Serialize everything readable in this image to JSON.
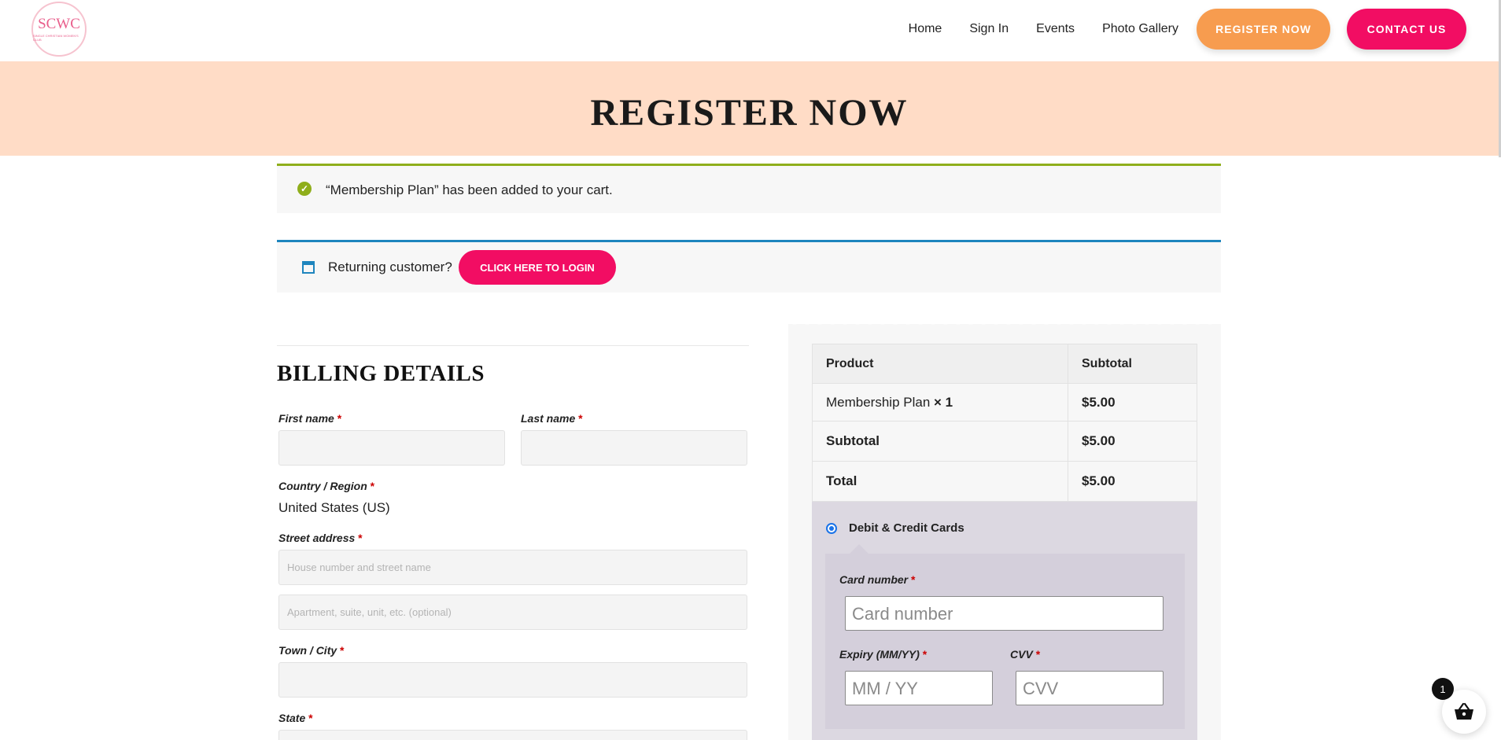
{
  "header": {
    "logo_text": "SCWC",
    "logo_subtext": "SINGLE CHRISTIAN WOMEN'S CLUB",
    "nav": [
      {
        "label": "Home"
      },
      {
        "label": "Sign In"
      },
      {
        "label": "Events"
      },
      {
        "label": "Photo Gallery"
      }
    ],
    "register_label": "REGISTER NOW",
    "contact_label": "CONTACT US"
  },
  "hero": {
    "title": "REGISTER NOW"
  },
  "notices": {
    "cart_message": "“Membership Plan” has been added to your cart.",
    "returning_text": "Returning customer?",
    "login_button": "CLICK HERE TO LOGIN"
  },
  "billing": {
    "title": "BILLING DETAILS",
    "first_name_label": "First name",
    "last_name_label": "Last name",
    "country_label": "Country / Region",
    "country_value": "United States (US)",
    "street_label": "Street address",
    "street_placeholder_1": "House number and street name",
    "street_placeholder_2": "Apartment, suite, unit, etc. (optional)",
    "city_label": "Town / City",
    "state_label": "State",
    "required_mark": "*"
  },
  "order": {
    "col_product": "Product",
    "col_subtotal": "Subtotal",
    "item_name": "Membership Plan",
    "item_qty": "× 1",
    "item_price": "$5.00",
    "subtotal_label": "Subtotal",
    "subtotal_value": "$5.00",
    "total_label": "Total",
    "total_value": "$5.00"
  },
  "payment": {
    "method_label": "Debit & Credit Cards",
    "card_number_label": "Card number",
    "card_number_placeholder": "Card number",
    "expiry_label": "Expiry (MM/YY)",
    "expiry_placeholder": "MM / YY",
    "cvv_label": "CVV",
    "cvv_placeholder": "CVV"
  },
  "cart": {
    "count": "1"
  },
  "colors": {
    "accent_pink": "#f20d63",
    "accent_orange": "#f79c4f",
    "hero_bg": "#ffdcc6",
    "success_green": "#8fae1b",
    "info_blue": "#1e85be"
  }
}
